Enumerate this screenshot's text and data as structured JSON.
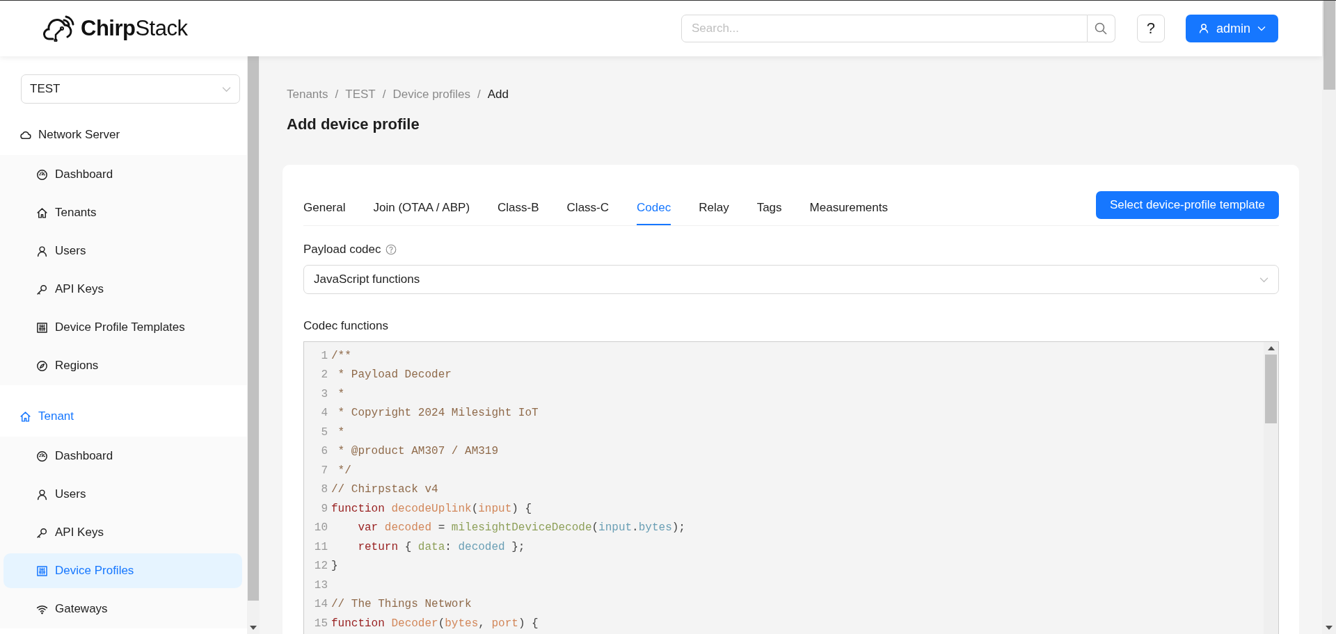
{
  "header": {
    "logo": "**Chirp**Stack",
    "search": {
      "placeholder": "Search..."
    },
    "help_button": "?",
    "user_button": "admin"
  },
  "sidebar": {
    "tenant_select": "TEST",
    "sections": [
      {
        "label": "Network Server",
        "kind": "cloud",
        "active": false,
        "items": [
          {
            "label": "Dashboard",
            "kind": "dashboard",
            "selected": false
          },
          {
            "label": "Tenants",
            "kind": "home",
            "selected": false
          },
          {
            "label": "Users",
            "kind": "user",
            "selected": false
          },
          {
            "label": "API Keys",
            "kind": "key",
            "selected": false
          },
          {
            "label": "Device Profile Templates",
            "kind": "sliders",
            "selected": false
          },
          {
            "label": "Regions",
            "kind": "compass",
            "selected": false
          }
        ]
      },
      {
        "label": "Tenant",
        "kind": "home",
        "active": true,
        "items": [
          {
            "label": "Dashboard",
            "kind": "dashboard",
            "selected": false
          },
          {
            "label": "Users",
            "kind": "user",
            "selected": false
          },
          {
            "label": "API Keys",
            "kind": "key",
            "selected": false
          },
          {
            "label": "Device Profiles",
            "kind": "sliders",
            "selected": true
          },
          {
            "label": "Gateways",
            "kind": "wifi",
            "selected": false
          }
        ]
      }
    ]
  },
  "breadcrumb": {
    "items": [
      "Tenants",
      "TEST",
      "Device profiles",
      "Add"
    ],
    "separators": [
      "/",
      "/",
      "/"
    ]
  },
  "title": "Add device profile",
  "tabs": [
    {
      "label": "General",
      "selected": false
    },
    {
      "label": "Join (OTAA / ABP)",
      "selected": false
    },
    {
      "label": "Class-B",
      "selected": false
    },
    {
      "label": "Class-C",
      "selected": false
    },
    {
      "label": "Codec",
      "selected": true
    },
    {
      "label": "Relay",
      "selected": false
    },
    {
      "label": "Tags",
      "selected": false
    },
    {
      "label": "Measurements",
      "selected": false
    }
  ],
  "template_button": "Select device-profile template",
  "payload_codec": {
    "label": "Payload codec",
    "value": "JavaScript functions"
  },
  "codec_functions": {
    "label": "Codec functions",
    "lines": [
      {
        "number": "1",
        "tokens": [
          {
            "kind": "comment",
            "text": "/**"
          }
        ]
      },
      {
        "number": "2",
        "tokens": [
          {
            "kind": "comment",
            "text": " * Payload Decoder"
          }
        ]
      },
      {
        "number": "3",
        "tokens": [
          {
            "kind": "comment",
            "text": " *"
          }
        ]
      },
      {
        "number": "4",
        "tokens": [
          {
            "kind": "comment",
            "text": " * Copyright 2024 Milesight IoT"
          }
        ]
      },
      {
        "number": "5",
        "tokens": [
          {
            "kind": "comment",
            "text": " *"
          }
        ]
      },
      {
        "number": "6",
        "tokens": [
          {
            "kind": "comment",
            "text": " * @product AM307 / AM319"
          }
        ]
      },
      {
        "number": "7",
        "tokens": [
          {
            "kind": "comment",
            "text": " */"
          }
        ]
      },
      {
        "number": "8",
        "tokens": [
          {
            "kind": "comment",
            "text": "// Chirpstack v4"
          }
        ]
      },
      {
        "number": "9",
        "tokens": [
          {
            "kind": "keyword",
            "text": "function "
          },
          {
            "kind": "def",
            "text": "decodeUplink"
          },
          {
            "kind": "punct",
            "text": "("
          },
          {
            "kind": "def",
            "text": "input"
          },
          {
            "kind": "punct",
            "text": ") {"
          }
        ]
      },
      {
        "number": "10",
        "tokens": [
          {
            "kind": "keyword",
            "text": "    var "
          },
          {
            "kind": "def",
            "text": "decoded"
          },
          {
            "kind": "punct",
            "text": " = "
          },
          {
            "kind": "call",
            "text": "milesightDeviceDecode"
          },
          {
            "kind": "punct",
            "text": "("
          },
          {
            "kind": "prop",
            "text": "input"
          },
          {
            "kind": "punct",
            "text": "."
          },
          {
            "kind": "prop",
            "text": "bytes"
          },
          {
            "kind": "punct",
            "text": ");"
          }
        ]
      },
      {
        "number": "11",
        "tokens": [
          {
            "kind": "keyword",
            "text": "    return "
          },
          {
            "kind": "punct",
            "text": "{ "
          },
          {
            "kind": "call",
            "text": "data"
          },
          {
            "kind": "punct",
            "text": ": "
          },
          {
            "kind": "prop",
            "text": "decoded"
          },
          {
            "kind": "punct",
            "text": " };"
          }
        ]
      },
      {
        "number": "12",
        "tokens": [
          {
            "kind": "punct",
            "text": "}"
          }
        ]
      },
      {
        "number": "13"
      },
      {
        "number": "14",
        "tokens": [
          {
            "kind": "comment",
            "text": "// The Things Network"
          }
        ]
      },
      {
        "number": "15",
        "tokens": [
          {
            "kind": "keyword",
            "text": "function "
          },
          {
            "kind": "def",
            "text": "Decoder"
          },
          {
            "kind": "punct",
            "text": "("
          },
          {
            "kind": "def",
            "text": "bytes"
          },
          {
            "kind": "punct",
            "text": ", "
          },
          {
            "kind": "def",
            "text": "port"
          },
          {
            "kind": "punct",
            "text": ") {"
          }
        ]
      }
    ]
  }
}
